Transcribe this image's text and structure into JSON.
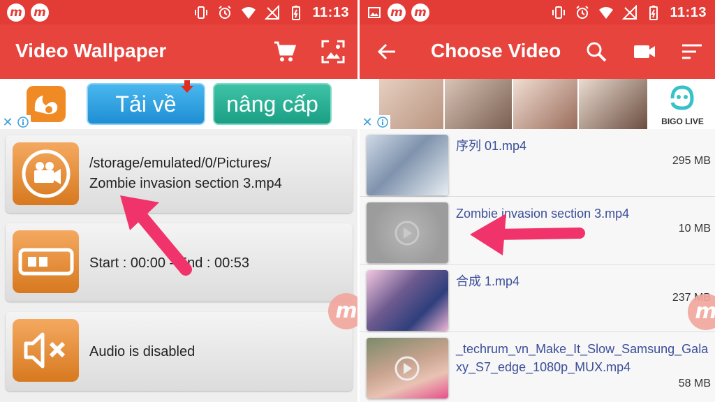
{
  "status_bar": {
    "time": "11:13",
    "logo_letter": "m"
  },
  "left_screen": {
    "title": "Video Wallpaper",
    "ad": {
      "button_download": "Tải về",
      "button_upgrade": "nâng cấp"
    },
    "cards": {
      "video_path_line1": "/storage/emulated/0/Pictures/",
      "video_path_line2": "Zombie invasion section 3.mp4",
      "time_range": "Start : 00:00 - End : 00:53",
      "audio_status": "Audio is disabled"
    }
  },
  "right_screen": {
    "title": "Choose Video",
    "ad": {
      "brand": "BIGO LIVE"
    },
    "videos": [
      {
        "name": "序列 01.mp4",
        "size": "295 MB"
      },
      {
        "name": "Zombie invasion section 3.mp4",
        "size": "10 MB"
      },
      {
        "name": "合成 1.mp4",
        "size": "237 MB"
      },
      {
        "name": "_techrum_vn_Make_It_Slow_Samsung_Galaxy_S7_edge_1080p_MUX.mp4",
        "size": "58 MB"
      }
    ]
  },
  "colors": {
    "status_bar": "#e33b36",
    "app_bar": "#e8443e",
    "icon_orange": "#e38a2e",
    "annotation_arrow": "#f0336b"
  },
  "icons": [
    "cart-icon",
    "wallpaper-icon",
    "back-icon",
    "search-icon",
    "camera-icon",
    "sort-icon",
    "video-camera-icon",
    "timeline-icon",
    "mute-icon"
  ]
}
